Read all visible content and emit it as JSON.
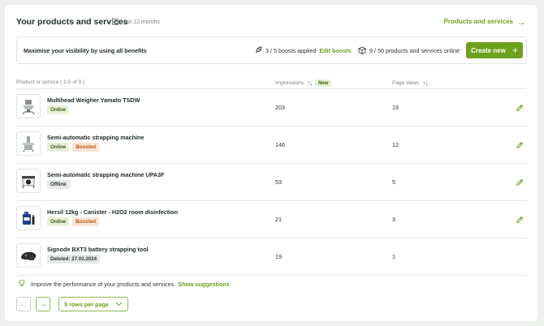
{
  "header": {
    "title": "Your products and services",
    "period": "Last 12 months",
    "link": "Products and services"
  },
  "banner": {
    "text": "Maximise your visibility by using all benefits",
    "boosts": "3 / 5 boosts applied",
    "edit_boosts": "Edit boosts",
    "products_online": "9 / 50 products and services online",
    "create_label": "Create new"
  },
  "table": {
    "col_product": "Product or service ( 1-5 of 9 )",
    "col_impressions": "Impressions",
    "new_badge": "New",
    "col_pageviews": "Page views",
    "rows": [
      {
        "name": "Multihead Weigher Yamato TSDW",
        "status": "Online",
        "boost": "",
        "impressions": "203",
        "pageviews": "19"
      },
      {
        "name": "Semi-automatic strapping machine",
        "status": "Online",
        "boost": "Boosted",
        "impressions": "146",
        "pageviews": "12"
      },
      {
        "name": "Semi-automatic strapping machine UPA3F",
        "status": "Offline",
        "boost": "",
        "impressions": "53",
        "pageviews": "5"
      },
      {
        "name": "Hersil 12kg - Canister - H2O2 room disinfection",
        "status": "Online",
        "boost": "Boosted",
        "impressions": "21",
        "pageviews": "3"
      },
      {
        "name": "Signode BXT3 battery strapping tool",
        "status": "Deleted: 27.03.2024",
        "boost": "",
        "impressions": "19",
        "pageviews": "1"
      }
    ]
  },
  "suggestion": {
    "text": "Improve the performance of your products and services.",
    "link": "Show suggestions"
  },
  "pagination": {
    "rows_per_page": "5 rows per page"
  },
  "colors": {
    "accent": "#6ca11d",
    "online_bg": "#e6f0d8",
    "boosted_bg": "#fbe3d1"
  }
}
